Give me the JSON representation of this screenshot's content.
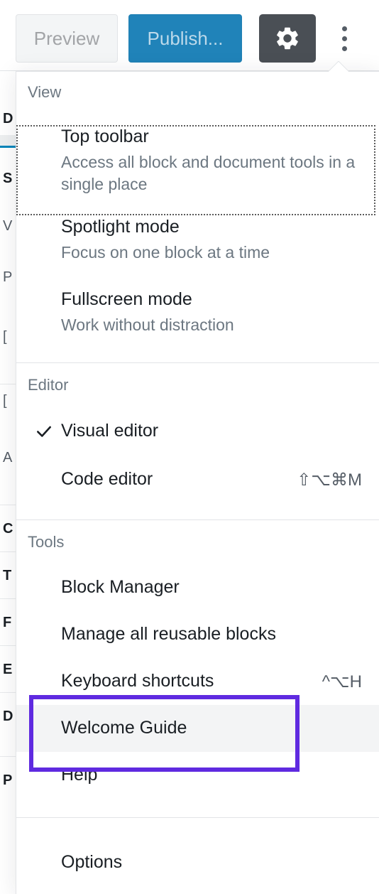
{
  "toolbar": {
    "preview_label": "Preview",
    "publish_label": "Publish...",
    "settings_icon": "gear-icon",
    "more_options_icon": "kebab-menu-icon",
    "publish_color": "#2083b9",
    "settings_bg_color": "#4a4f55"
  },
  "background": {
    "sidebar_rows": [
      {
        "glyph": "D",
        "active": false
      },
      {
        "glyph": "",
        "active": true
      },
      {
        "glyph": "S",
        "active": false
      },
      {
        "glyph": "V",
        "active": false
      },
      {
        "glyph": "P",
        "active": false
      },
      {
        "glyph": "[",
        "active": false
      },
      {
        "glyph": "[",
        "active": false
      },
      {
        "glyph": "A",
        "active": false
      },
      {
        "glyph": "C",
        "active": false
      },
      {
        "glyph": "T",
        "active": false
      },
      {
        "glyph": "F",
        "active": false
      },
      {
        "glyph": "E",
        "active": false
      },
      {
        "glyph": "D",
        "active": false
      },
      {
        "glyph": "P",
        "active": false
      }
    ]
  },
  "menu": {
    "accent_highlight_color": "#5f2ae0",
    "sections": [
      {
        "label": "View",
        "items": [
          {
            "title": "Top toolbar",
            "description": "Access all block and document tools in a single place",
            "shortcut": "",
            "checked": false,
            "focused": true,
            "hovered": false
          },
          {
            "title": "Spotlight mode",
            "description": "Focus on one block at a time",
            "shortcut": "",
            "checked": false,
            "focused": false,
            "hovered": false
          },
          {
            "title": "Fullscreen mode",
            "description": "Work without distraction",
            "shortcut": "",
            "checked": false,
            "focused": false,
            "hovered": false
          }
        ]
      },
      {
        "label": "Editor",
        "items": [
          {
            "title": "Visual editor",
            "description": "",
            "shortcut": "",
            "checked": true,
            "focused": false,
            "hovered": false
          },
          {
            "title": "Code editor",
            "description": "",
            "shortcut": "⇧⌥⌘M",
            "checked": false,
            "focused": false,
            "hovered": false
          }
        ]
      },
      {
        "label": "Tools",
        "items": [
          {
            "title": "Block Manager",
            "description": "",
            "shortcut": "",
            "checked": false,
            "focused": false,
            "hovered": false
          },
          {
            "title": "Manage all reusable blocks",
            "description": "",
            "shortcut": "",
            "checked": false,
            "focused": false,
            "hovered": false
          },
          {
            "title": "Keyboard shortcuts",
            "description": "",
            "shortcut": "^⌥H",
            "checked": false,
            "focused": false,
            "hovered": false
          },
          {
            "title": "Welcome Guide",
            "description": "",
            "shortcut": "",
            "checked": false,
            "focused": false,
            "hovered": true,
            "annotated": true
          },
          {
            "title": "Help",
            "description": "",
            "shortcut": "",
            "checked": false,
            "focused": false,
            "hovered": false
          }
        ]
      },
      {
        "label": "",
        "items": [
          {
            "title": "Options",
            "description": "",
            "shortcut": "",
            "checked": false,
            "focused": false,
            "hovered": false
          }
        ]
      }
    ]
  }
}
